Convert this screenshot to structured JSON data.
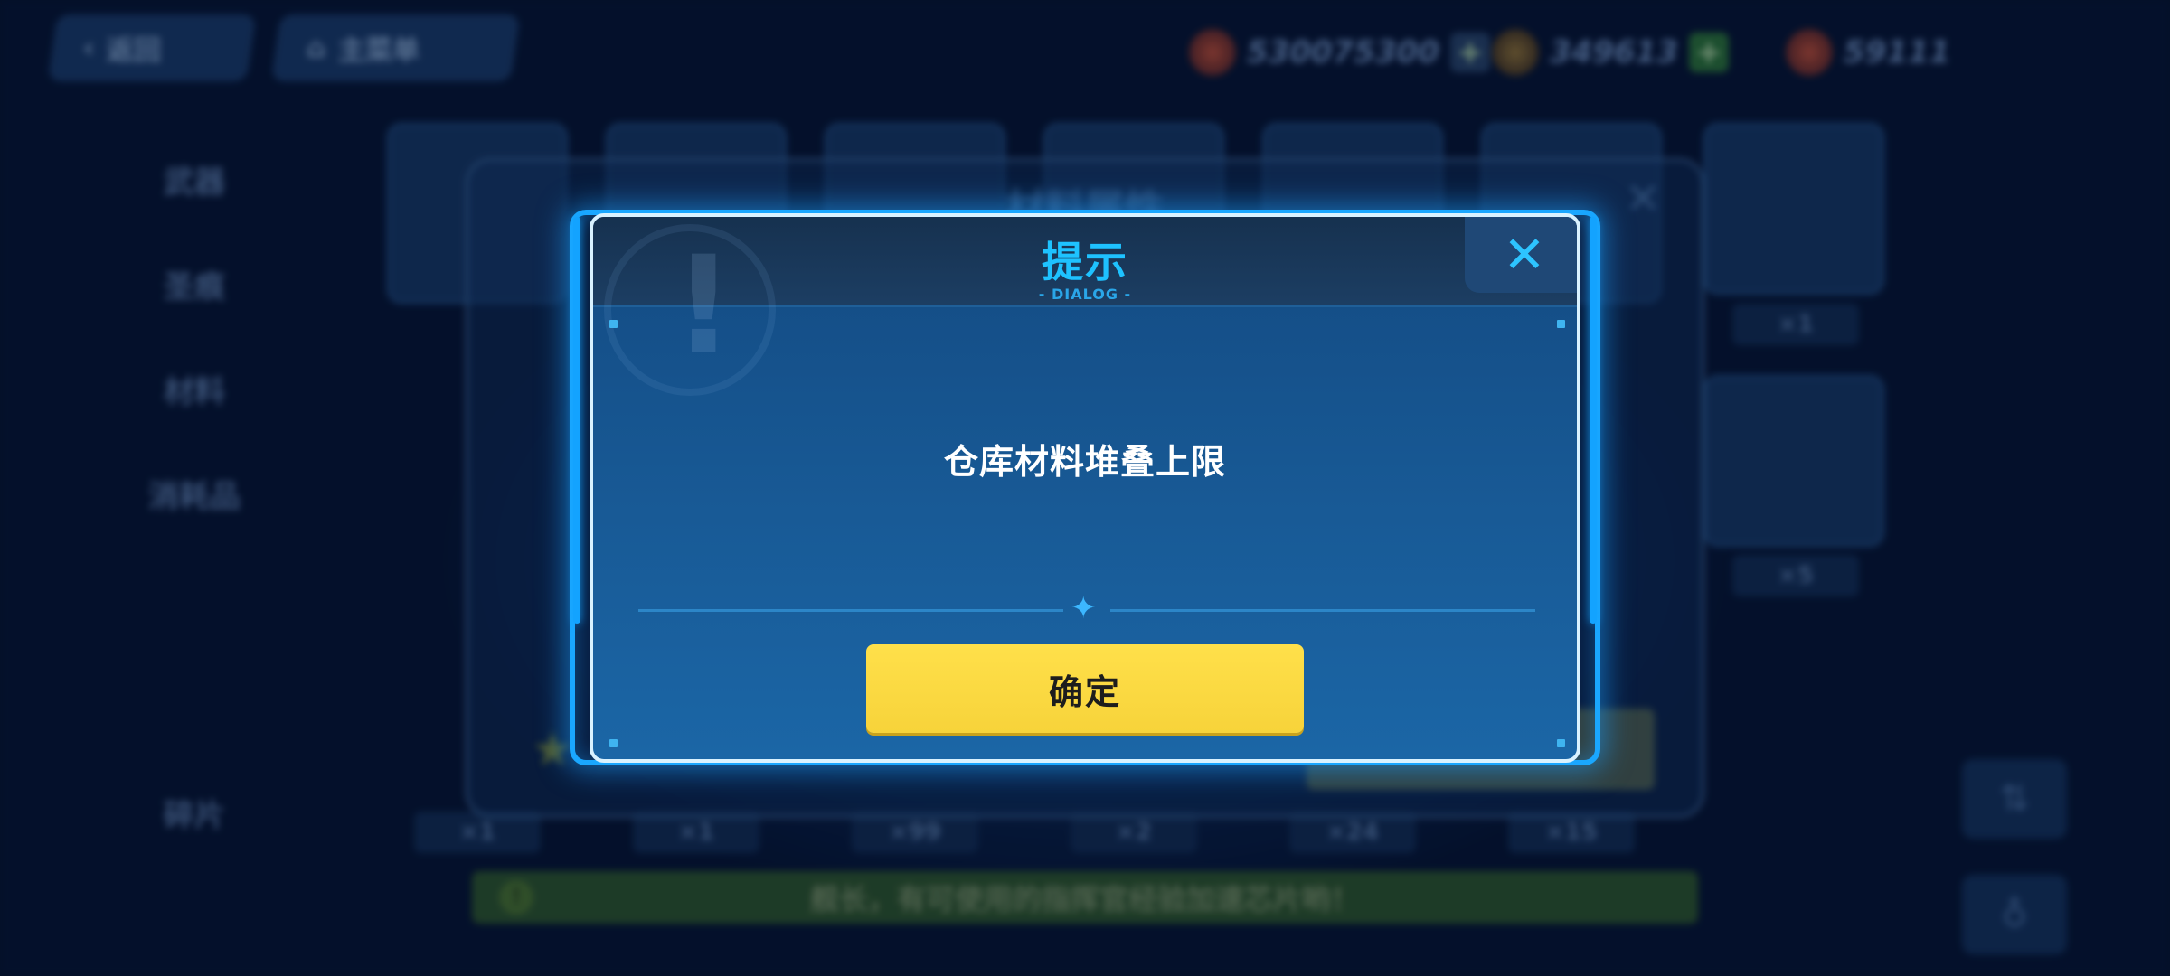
{
  "topbar": {
    "back_label": "返回",
    "main_menu_label": "主菜单",
    "resources": [
      {
        "icon": "stamina-icon",
        "value": "530075300"
      },
      {
        "icon": "crystal-icon",
        "value": "349613"
      },
      {
        "icon": "coin-icon",
        "value": "59111"
      }
    ]
  },
  "sidebar": {
    "items": [
      {
        "label": "武器"
      },
      {
        "label": "圣痕"
      },
      {
        "label": "材料"
      },
      {
        "label": "消耗品"
      },
      {
        "label": "碎片"
      }
    ]
  },
  "background_panel": {
    "title": "材料属性",
    "card_counts": [
      "×1",
      "×1",
      "×99",
      "×2",
      "×24",
      "×15"
    ],
    "right_counts": [
      "×1",
      "×5"
    ]
  },
  "notice": {
    "text": "舰长，有可使用的指挥官经验加速芯片哟！"
  },
  "dialog": {
    "title": "提示",
    "subtitle": "- DIALOG -",
    "message": "仓库材料堆叠上限",
    "confirm_label": "确定",
    "close_symbol": "✕"
  },
  "colors": {
    "accent": "#1ec2ff",
    "confirm_button": "#ffe04a",
    "dialog_border": "#d9f2ff"
  }
}
